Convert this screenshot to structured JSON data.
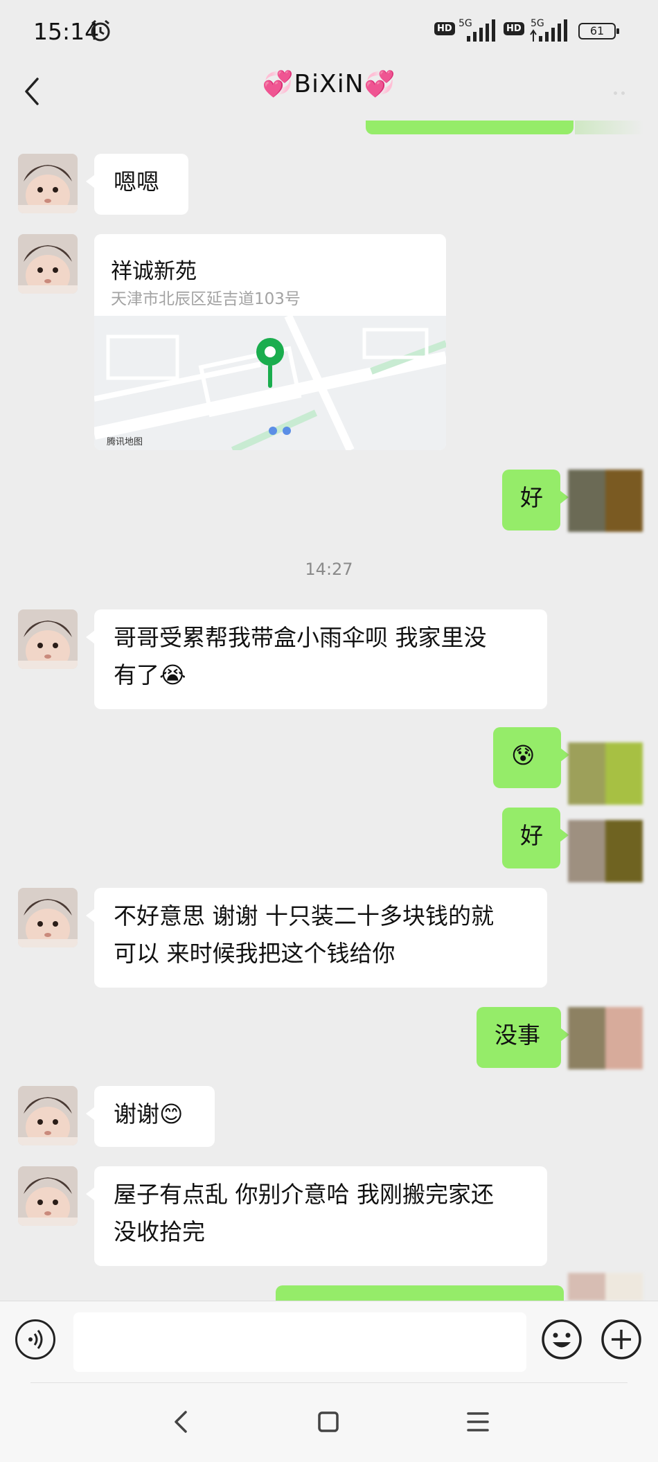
{
  "status_bar": {
    "time": "15:14",
    "hd1": "HD",
    "net1": "5G",
    "hd2": "HD",
    "net2": "5G",
    "battery": "61"
  },
  "header": {
    "title": "💞BiXiN💞"
  },
  "messages": {
    "m1": "嗯嗯",
    "location": {
      "name": "祥诚新苑",
      "address": "天津市北辰区延吉道103号",
      "map_logo": "腾讯地图"
    },
    "m2": "好",
    "timestamp": "14:27",
    "m3_line1": "哥哥受累帮我带盒小雨伞呗 我家里没",
    "m3_line2": "有了😭",
    "m4": "😰",
    "m5": "好",
    "m6_line1": "不好意思 谢谢 十只装二十多块钱的就",
    "m6_line2": "可以 来时候我把这个钱给你",
    "m7": "没事",
    "m8": "谢谢😊",
    "m9_line1": "屋子有点乱 你别介意哈 我刚搬完家还",
    "m9_line2": "没收拾完"
  },
  "colors": {
    "sent_bubble": "#95ec69",
    "received_bubble": "#ffffff",
    "background": "#ededed"
  },
  "icons": [
    "back-icon",
    "more-icon",
    "voice-icon",
    "emoji-icon",
    "plus-icon",
    "nav-back-icon",
    "nav-home-icon",
    "nav-menu-icon"
  ]
}
